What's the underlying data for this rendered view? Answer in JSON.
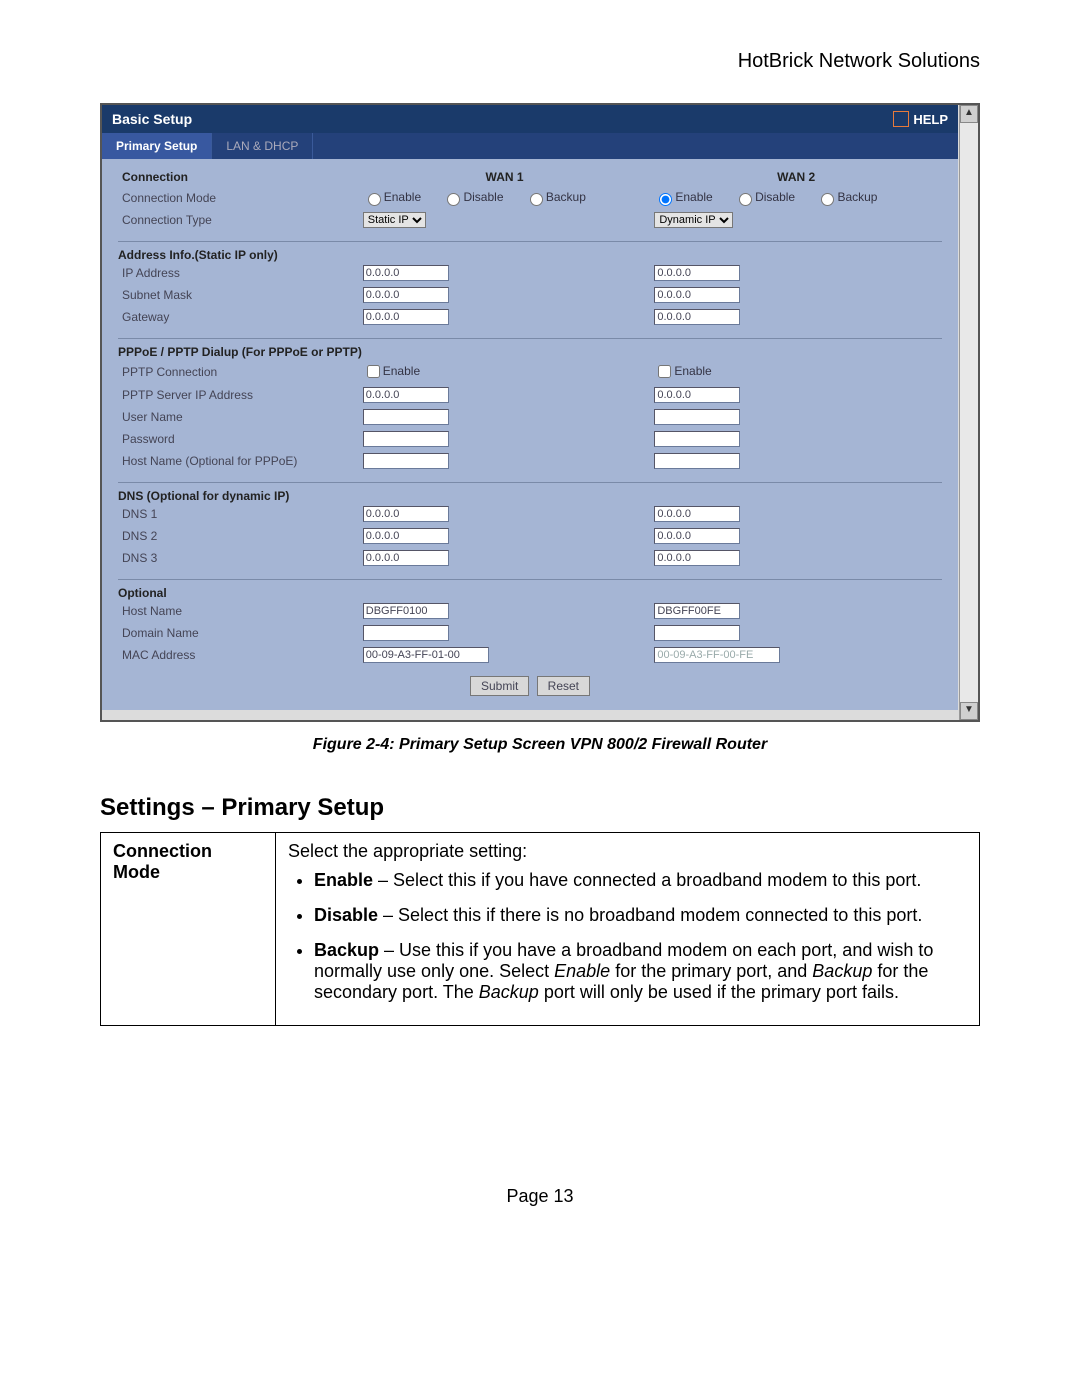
{
  "doc": {
    "header_right": "HotBrick Network Solutions",
    "figure_caption": "Figure 2-4: Primary Setup Screen VPN 800/2 Firewall Router",
    "settings_heading": "Settings – Primary Setup",
    "page_footer": "Page 13"
  },
  "router": {
    "title": "Basic Setup",
    "help": "HELP",
    "tabs": {
      "primary": "Primary Setup",
      "lan": "LAN & DHCP"
    },
    "headers": {
      "connection": "Connection",
      "wan1": "WAN 1",
      "wan2": "WAN 2"
    },
    "labels": {
      "conn_mode": "Connection Mode",
      "conn_type": "Connection Type",
      "addr_info": "Address Info.(Static IP only)",
      "ip": "IP Address",
      "subnet": "Subnet Mask",
      "gateway": "Gateway",
      "pppoe_head": "PPPoE / PPTP Dialup (For PPPoE or PPTP)",
      "pptp_conn": "PPTP Connection",
      "pptp_server": "PPTP Server IP Address",
      "user": "User Name",
      "pass": "Password",
      "hostopt": "Host Name (Optional for PPPoE)",
      "dns_head": "DNS (Optional for dynamic IP)",
      "dns1": "DNS 1",
      "dns2": "DNS 2",
      "dns3": "DNS 3",
      "optional": "Optional",
      "hostname": "Host Name",
      "domain": "Domain Name",
      "mac": "MAC Address"
    },
    "radios": {
      "enable": "Enable",
      "disable": "Disable",
      "backup": "Backup"
    },
    "conn_type": {
      "w1": "Static IP",
      "w2": "Dynamic IP"
    },
    "values": {
      "zero": "0.0.0.0",
      "host_w1": "DBGFF0100",
      "host_w2": "DBGFF00FE",
      "mac_w1": "00-09-A3-FF-01-00",
      "mac_w2": "00-09-A3-FF-00-FE"
    },
    "buttons": {
      "submit": "Submit",
      "reset": "Reset"
    }
  },
  "settings_table": {
    "key": "Connection Mode",
    "intro": "Select the appropriate setting:",
    "items": [
      {
        "bold": "Enable",
        "text": " – Select this if you have connected a broadband modem to this port."
      },
      {
        "bold": "Disable",
        "text": " – Select this if there is no broadband modem connected to this port."
      },
      {
        "bold": "Backup",
        "text_before": " – Use this if you have a broadband modem on each port, and wish to normally use only one. Select ",
        "em1": "Enable",
        "mid1": " for the primary port, and ",
        "em2": "Backup",
        "mid2": " for the secondary port. The ",
        "em3": "Backup",
        "tail": " port will only be used if the primary port fails."
      }
    ]
  }
}
